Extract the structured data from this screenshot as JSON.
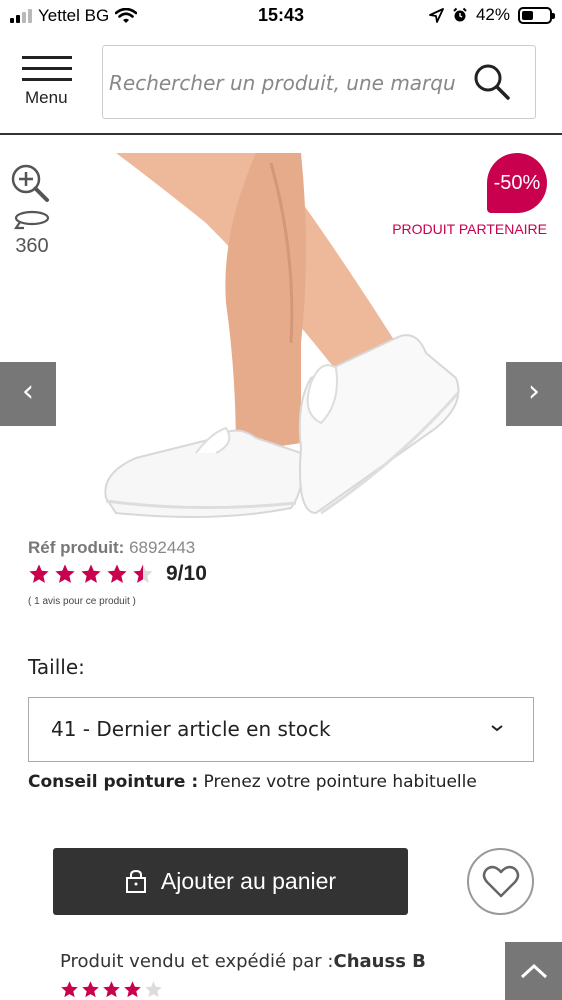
{
  "status_bar": {
    "carrier": "Yettel BG",
    "time": "15:43",
    "battery": "42%",
    "battery_level": 0.42
  },
  "header": {
    "menu_label": "Menu",
    "search_placeholder": "Rechercher un produit, une marqu"
  },
  "product": {
    "badge": "-50%",
    "partner_label": "PRODUIT PARTENAIRE",
    "rotate_label": "360",
    "prev_label": "‹",
    "next_label": "›",
    "ref_label": "Réf produit:",
    "ref_value": "6892443",
    "rating_stars": 4.5,
    "rating_score": "9/10",
    "review_count": "( 1 avis pour ce produit )"
  },
  "size": {
    "label": "Taille:",
    "selected": "41 -  Dernier article en stock",
    "advice_label": "Conseil pointure :",
    "advice_text": " Prenez votre pointure habituelle"
  },
  "actions": {
    "add_to_cart": "Ajouter au panier"
  },
  "seller": {
    "prefix": "Produit vendu et expédié par :",
    "name": "Chauss B",
    "rating_stars": 4
  },
  "colors": {
    "accent": "#c8004e",
    "button_dark": "#333333",
    "nav_gray": "#777777"
  }
}
